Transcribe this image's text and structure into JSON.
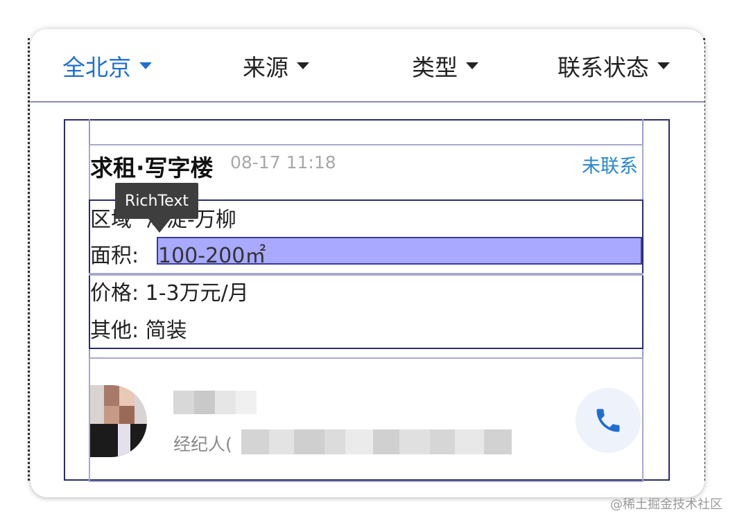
{
  "filters": [
    {
      "label": "全北京",
      "active": true
    },
    {
      "label": "来源",
      "active": false
    },
    {
      "label": "类型",
      "active": false
    },
    {
      "label": "联系状态",
      "active": false
    }
  ],
  "listing": {
    "title": "求租·写字楼",
    "time": "08-17 11:18",
    "status": "未联系",
    "area_label": "区域",
    "area_value": "海淀-万柳",
    "size_label": "面积:",
    "size_value": "100-200㎡",
    "price": "价格: 1-3万元/月",
    "other": "其他: 简装"
  },
  "tooltip": {
    "text": "RichText"
  },
  "agent": {
    "label": "经纪人("
  },
  "colors": {
    "accent": "#1e6fd0",
    "status": "#2a86cf",
    "highlight": "#a9a9ff"
  },
  "watermark": "@稀土掘金技术社区"
}
